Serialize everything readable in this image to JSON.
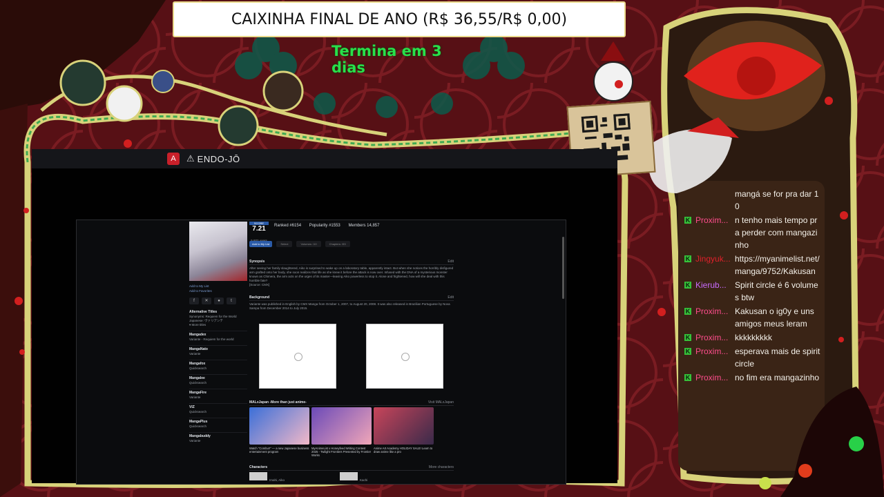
{
  "goal": {
    "title": "CAIXINHA FINAL DE ANO (R$ 36,55/R$ 0,00)",
    "timer": "Termina em 3 dias"
  },
  "capture": {
    "app_icon": "A",
    "warn_icon": "⚠",
    "title": "ENDO-JŌ"
  },
  "browser_page": {
    "score_label": "SCORE",
    "score_value": "7.21",
    "score_users": "5,602 users",
    "ranked": "Ranked #6154",
    "popularity": "Popularity #1553",
    "members": "Members 14,857",
    "add_list_button": "Add to My List",
    "select_placeholder": "Select",
    "volumes_field": "Volumes: /10",
    "chapters_field": "Chapters: /53",
    "left_links": [
      "Add to My List",
      "Add to Favorites"
    ],
    "alt_titles_heading": "Alternative Titles",
    "synonyms": "Synonyms: Requiem for the World",
    "japanese": "Japanese: ヴァリアンテ",
    "more_titles": "▾ More titles",
    "sites": [
      {
        "name": "Mangadex",
        "sub": "Variante - Requiem for the world"
      },
      {
        "name": "MangaNato",
        "sub": "Variante"
      },
      {
        "name": "Mangafox",
        "sub": "Quicksearch"
      },
      {
        "name": "Mangalee",
        "sub": "Quicksearch"
      },
      {
        "name": "MangaFire",
        "sub": "Variante"
      },
      {
        "name": "VIZ",
        "sub": "Quicksearch"
      },
      {
        "name": "MangaPlus",
        "sub": "Quicksearch"
      },
      {
        "name": "Mangabuddy",
        "sub": "Variante"
      }
    ],
    "synopsis_heading": "Synopsis",
    "synopsis_edit": "Edit",
    "synopsis_text": "After seeing her family slaughtered, Aiko is surprised to wake up on a laboratory table, apparently intact. But when she notices the horribly disfigured arm grafted onto her body, she soon realizes that life as she knew it before the attack is now over. Infused with the DNA of a mysterious monster known as Chimera, the arm acts on the urges of its master—leaving Aiko powerless to stop it. Alone and frightened, how will she deal with this horrible fate?",
    "synopsis_source": "[Source: CMX]",
    "background_heading": "Background",
    "background_edit": "Edit",
    "background_text": "Variante was published in English by CMX Manga from October 1, 2007, to August 20, 2008. It was also released in Brazilian Portuguese by Nova Sampa from December 2014 to July 2015.",
    "news_heading": "MALxJapan -More than just anime-",
    "news_link": "Visit MALxJapan",
    "news": [
      {
        "caption": "Watch \"Combu!!\" — a new Japanese business entertainment program",
        "c1": "#3b6fd8",
        "c2": "#f2b8c8"
      },
      {
        "caption": "MyAnimeList x Honeyfeed Writing Contest 2025 - Twilight Frontiers Presented by Frontier Works",
        "c1": "#6b4ab8",
        "c2": "#f0a6b8"
      },
      {
        "caption": "Anime Art Academy HOLIDAY SALE! Learn to draw anime like a pro",
        "c1": "#c8455a",
        "c2": "#3a2a4a"
      }
    ],
    "characters_heading": "Characters",
    "characters_link": "More characters",
    "characters": [
      "Imahi, Aiko",
      "Kachi"
    ]
  },
  "chat": [
    {
      "user": "",
      "text": "mangá se for pra dar 10",
      "color": "#ffffff",
      "badge": false
    },
    {
      "user": "Proxim...",
      "text": "n tenho mais tempo pra perder com mangazinho",
      "color": "#ff4d8d",
      "badge": true
    },
    {
      "user": "Jingyuk...",
      "text": "https://myanimelist.net/manga/9752/Kakusan",
      "color": "#e0202a",
      "badge": true
    },
    {
      "user": "Kierub...",
      "text": "Spirit circle é 6 volumes btw",
      "color": "#c96bff",
      "badge": true
    },
    {
      "user": "Proxim...",
      "text": "Kakusan o ig0y e uns amigos meus leram",
      "color": "#ff4d8d",
      "badge": true
    },
    {
      "user": "Proxim...",
      "text": "kkkkkkkkk",
      "color": "#ff4d8d",
      "badge": true
    },
    {
      "user": "Proxim...",
      "text": "esperava mais de spirit circle",
      "color": "#ff4d8d",
      "badge": true
    },
    {
      "user": "Proxim...",
      "text": "no fim era mangazinho",
      "color": "#ff4d8d",
      "badge": true
    }
  ],
  "colors": {
    "backdrop": "#4a0c10",
    "frame_gold": "#d8d27a",
    "chat_panel": "#3a2416",
    "timer_green": "#28e04a",
    "badge_green": "#36c23a"
  }
}
